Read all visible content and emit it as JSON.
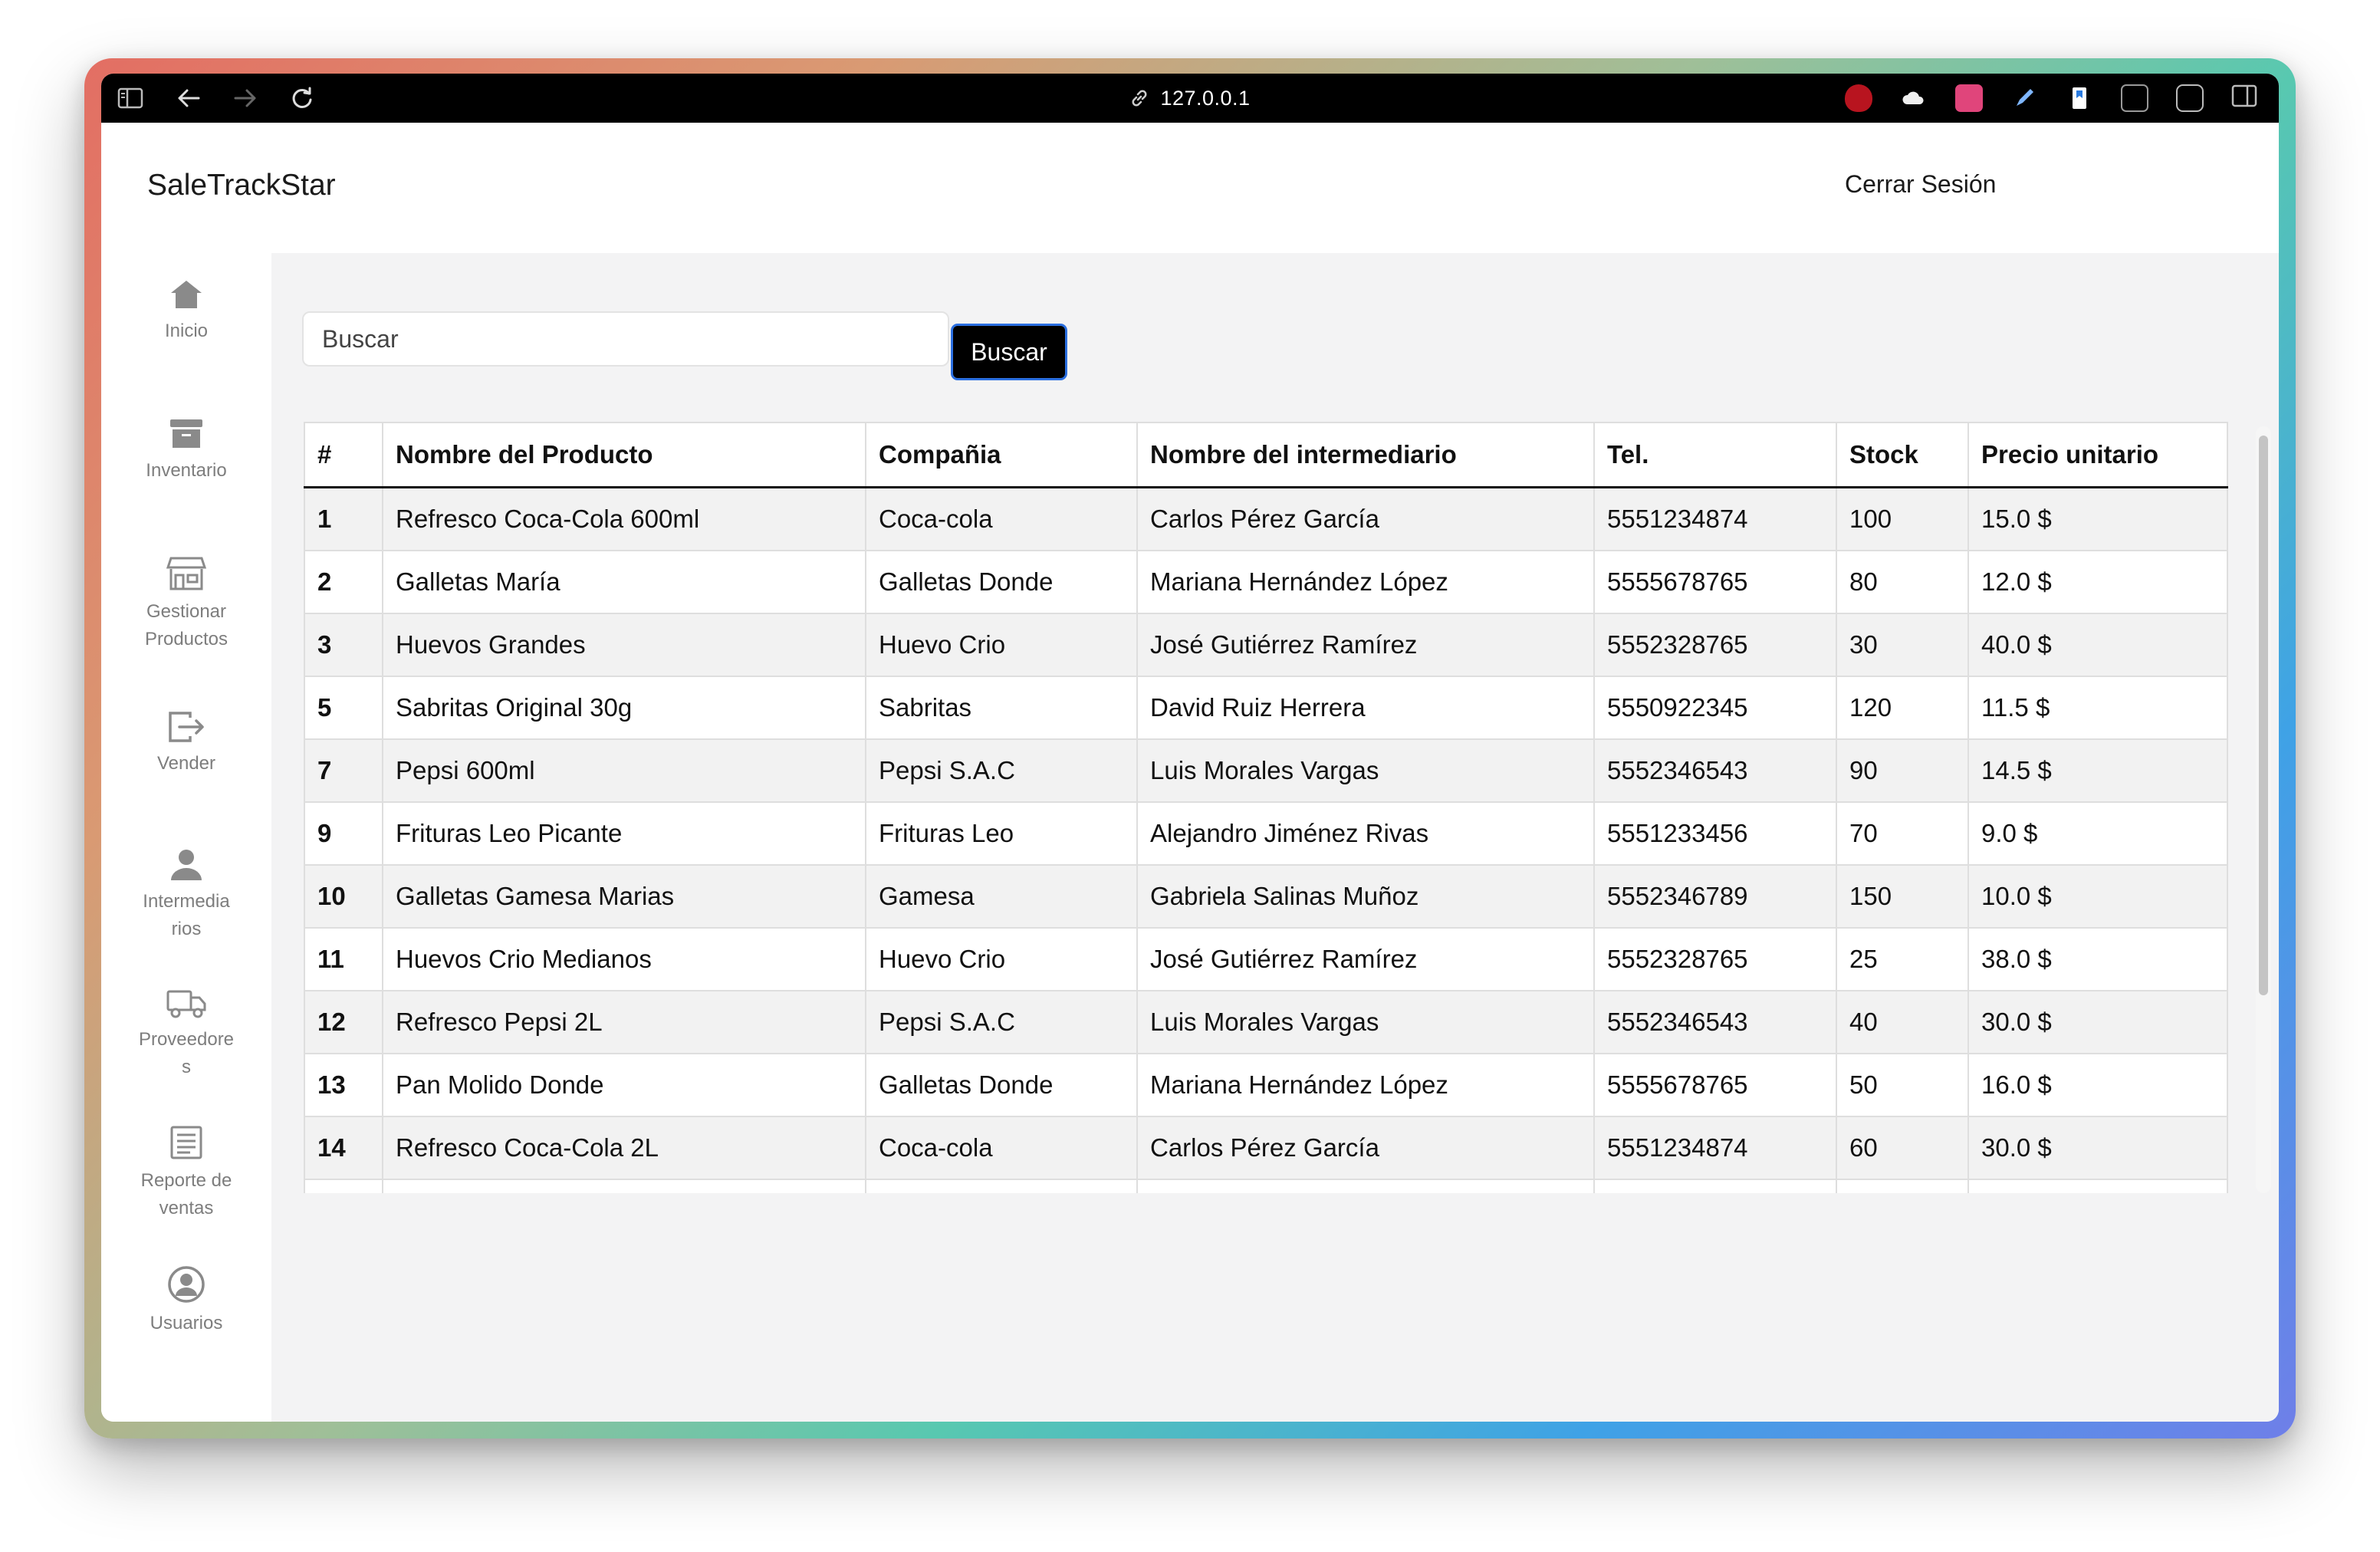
{
  "browser": {
    "url": "127.0.0.1",
    "icons": [
      "sidebar-icon",
      "back-arrow-icon",
      "forward-arrow-icon",
      "reload-icon",
      "link-icon"
    ],
    "extensions": [
      "ublock-icon",
      "cloud-icon",
      "translate-icon",
      "pen-icon",
      "bookmark-icon",
      "reader-icon",
      "tune-icon",
      "split-view-icon"
    ]
  },
  "header": {
    "brand": "SaleTrackStar",
    "logout": "Cerrar Sesión"
  },
  "sidebar": {
    "items": [
      {
        "label": "Inicio",
        "icon": "home-icon"
      },
      {
        "label": "Inventario",
        "icon": "archive-box-icon"
      },
      {
        "label": "Gestionar Productos",
        "icon": "store-icon"
      },
      {
        "label": "Vender",
        "icon": "exit-arrow-icon"
      },
      {
        "label": "Intermedia rios",
        "icon": "user-icon"
      },
      {
        "label": "Proveedore s",
        "icon": "truck-icon"
      },
      {
        "label": "Reporte de ventas",
        "icon": "report-icon"
      },
      {
        "label": "Usuarios",
        "icon": "user-circle-icon"
      }
    ]
  },
  "search": {
    "placeholder": "Buscar",
    "button": "Buscar"
  },
  "table": {
    "headers": [
      "#",
      "Nombre del Producto",
      "Compañia",
      "Nombre del intermediario",
      "Tel.",
      "Stock",
      "Precio unitario"
    ],
    "rows": [
      [
        "1",
        "Refresco Coca-Cola 600ml",
        "Coca-cola",
        "Carlos Pérez García",
        "5551234874",
        "100",
        "15.0 $"
      ],
      [
        "2",
        "Galletas María",
        "Galletas Donde",
        "Mariana Hernández López",
        "5555678765",
        "80",
        "12.0 $"
      ],
      [
        "3",
        "Huevos Grandes",
        "Huevo Crio",
        "José Gutiérrez Ramírez",
        "5552328765",
        "30",
        "40.0 $"
      ],
      [
        "5",
        "Sabritas Original 30g",
        "Sabritas",
        "David Ruiz Herrera",
        "5550922345",
        "120",
        "11.5 $"
      ],
      [
        "7",
        "Pepsi 600ml",
        "Pepsi S.A.C",
        "Luis Morales Vargas",
        "5552346543",
        "90",
        "14.5 $"
      ],
      [
        "9",
        "Frituras Leo Picante",
        "Frituras Leo",
        "Alejandro Jiménez Rivas",
        "5551233456",
        "70",
        "9.0 $"
      ],
      [
        "10",
        "Galletas Gamesa Marias",
        "Gamesa",
        "Gabriela Salinas Muñoz",
        "5552346789",
        "150",
        "10.0 $"
      ],
      [
        "11",
        "Huevos Crio Medianos",
        "Huevo Crio",
        "José Gutiérrez Ramírez",
        "5552328765",
        "25",
        "38.0 $"
      ],
      [
        "12",
        "Refresco Pepsi 2L",
        "Pepsi S.A.C",
        "Luis Morales Vargas",
        "5552346543",
        "40",
        "30.0 $"
      ],
      [
        "13",
        "Pan Molido Donde",
        "Galletas Donde",
        "Mariana Hernández López",
        "5555678765",
        "50",
        "16.0 $"
      ],
      [
        "14",
        "Refresco Coca-Cola 2L",
        "Coca-cola",
        "Carlos Pérez García",
        "5551234874",
        "60",
        "30.0 $"
      ],
      [
        "",
        "",
        "",
        "",
        "",
        "",
        ""
      ]
    ]
  }
}
